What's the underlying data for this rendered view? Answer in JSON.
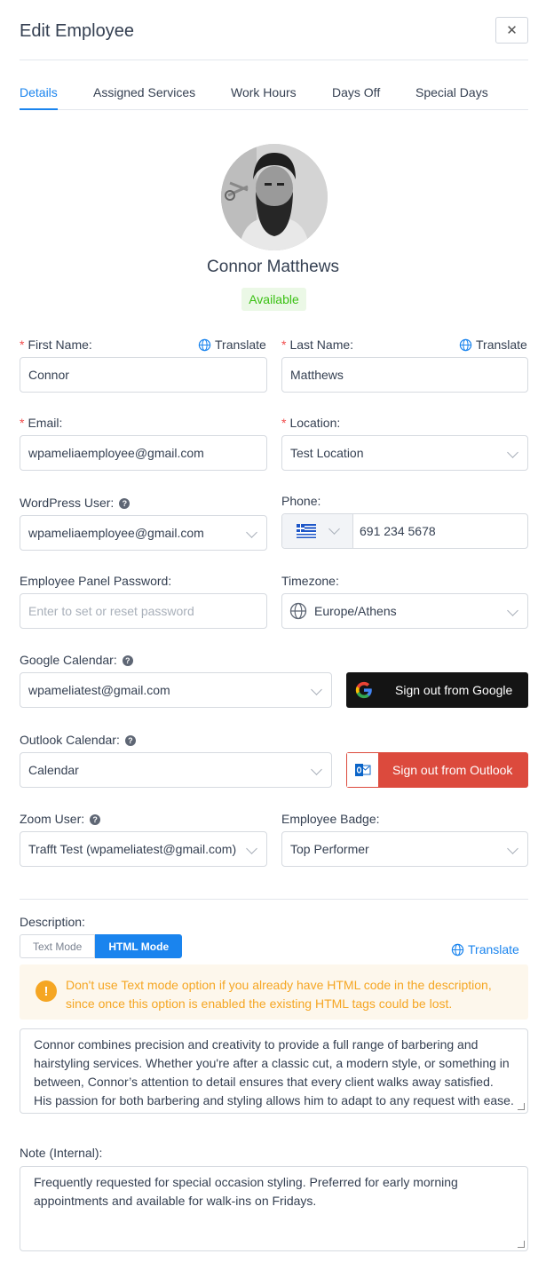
{
  "header": {
    "title": "Edit Employee",
    "close_label": "✕"
  },
  "tabs": [
    {
      "label": "Details",
      "active": true
    },
    {
      "label": "Assigned Services"
    },
    {
      "label": "Work Hours"
    },
    {
      "label": "Days Off"
    },
    {
      "label": "Special Days"
    }
  ],
  "profile": {
    "name": "Connor Matthews",
    "status": "Available"
  },
  "translate_label": "Translate",
  "fields": {
    "first_name": {
      "label": "First Name:",
      "value": "Connor"
    },
    "last_name": {
      "label": "Last Name:",
      "value": "Matthews"
    },
    "email": {
      "label": "Email:",
      "value": "wpameliaemployee@gmail.com"
    },
    "location": {
      "label": "Location:",
      "value": "Test Location"
    },
    "wp_user": {
      "label": "WordPress User:",
      "value": "wpameliaemployee@gmail.com"
    },
    "phone": {
      "label": "Phone:",
      "value": "691 234 5678",
      "country": "Greece"
    },
    "password": {
      "label": "Employee Panel Password:",
      "placeholder": "Enter to set or reset password"
    },
    "timezone": {
      "label": "Timezone:",
      "value": "Europe/Athens"
    },
    "google_calendar": {
      "label": "Google Calendar:",
      "value": "wpameliatest@gmail.com",
      "button": "Sign out from Google"
    },
    "outlook_calendar": {
      "label": "Outlook Calendar:",
      "value": "Calendar",
      "button": "Sign out from Outlook"
    },
    "zoom_user": {
      "label": "Zoom User:",
      "value": "Trafft Test (wpameliatest@gmail.com)"
    },
    "badge": {
      "label": "Employee Badge:",
      "value": "Top Performer"
    }
  },
  "description": {
    "label": "Description:",
    "modes": [
      "Text Mode",
      "HTML Mode"
    ],
    "active_mode": "HTML Mode",
    "warning": "Don't use Text mode option if you already have HTML code in the description, since once this option is enabled the existing HTML tags could be lost.",
    "text": "Connor combines precision and creativity to provide a full range of barbering and hairstyling services. Whether you're after a classic cut, a modern style, or something in between, Connor’s attention to detail ensures that every client walks away satisfied. His passion for both barbering and styling allows him to adapt to any request with ease."
  },
  "note": {
    "label": "Note (Internal):",
    "text": "Frequently requested for special occasion styling. Preferred for early morning appointments and available for walk-ins on Fridays."
  },
  "colors": {
    "accent": "#1a84ee",
    "success": "#3ac013",
    "warning": "#f5a623",
    "outlook": "#dc4a3d",
    "google_btn": "#141414"
  }
}
